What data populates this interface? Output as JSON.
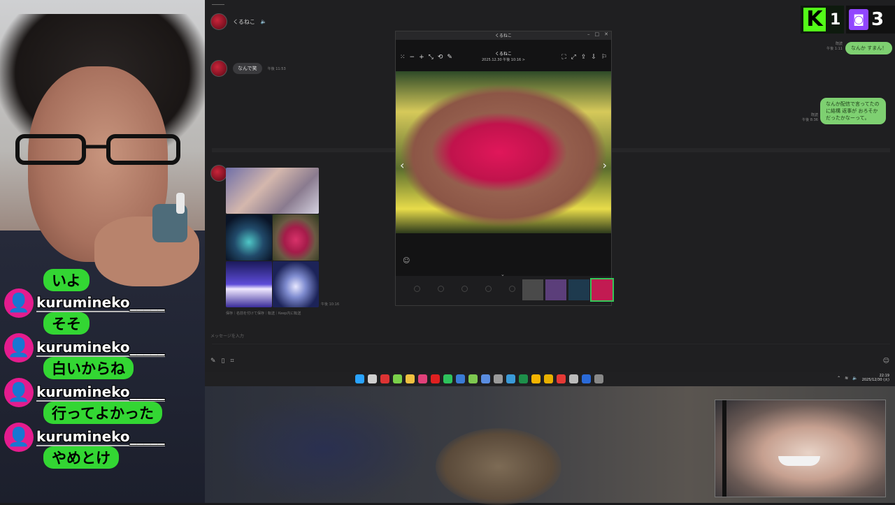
{
  "app": {
    "contact_name": "くるねこ",
    "messages": [
      {
        "sender": "くるねこ",
        "text": "なんで笑",
        "time": "午後 11:53"
      }
    ],
    "photo_caption": "保存｜名前を付けて保存｜転送｜Keep内に転送",
    "photo_time": "午後 10:16",
    "right_messages": [
      {
        "text": "なんか すまん！",
        "read": "既読",
        "time": "午後 1:11"
      },
      {
        "text": "なんか配信で言ってたのに結構 返事が おろそかだったかなーって。",
        "read": "既読",
        "time": "午後 8:36"
      }
    ],
    "input_placeholder": "メッセージを入力"
  },
  "viewer": {
    "window_title": "くるねこ",
    "header_name": "くるねこ",
    "header_date": "2025.12.30 午後 10:16 >",
    "thumb_colors": [
      "#4a4a4a",
      "#5b3e7a",
      "#1e3a4e",
      "#c21b52"
    ]
  },
  "taskbar": {
    "time": "22:19",
    "date": "2025/12/30 (火)",
    "icon_colors": [
      "#29a3ff",
      "#cfcfcf",
      "#d33",
      "#7ad04a",
      "#f0c040",
      "#e0407a",
      "#e02020",
      "#2ec25c",
      "#3a7bd5",
      "#7ec850",
      "#5a8de0",
      "#9a9a9a",
      "#3a9ad8",
      "#1d8f4a",
      "#f5b400",
      "#e8b000",
      "#e53935",
      "#bbbbbb",
      "#2a6ad8",
      "#888888"
    ]
  },
  "chat": [
    {
      "user": "",
      "message": "いよ"
    },
    {
      "user": "kurumineko_____",
      "message": "そそ"
    },
    {
      "user": "kurumineko_____",
      "message": "白いからね"
    },
    {
      "user": "kurumineko_____",
      "message": "行ってよかった"
    },
    {
      "user": "kurumineko_____",
      "message": "やめとけ"
    }
  ],
  "badges": {
    "kick_count": "1",
    "twitch_count": "3"
  }
}
